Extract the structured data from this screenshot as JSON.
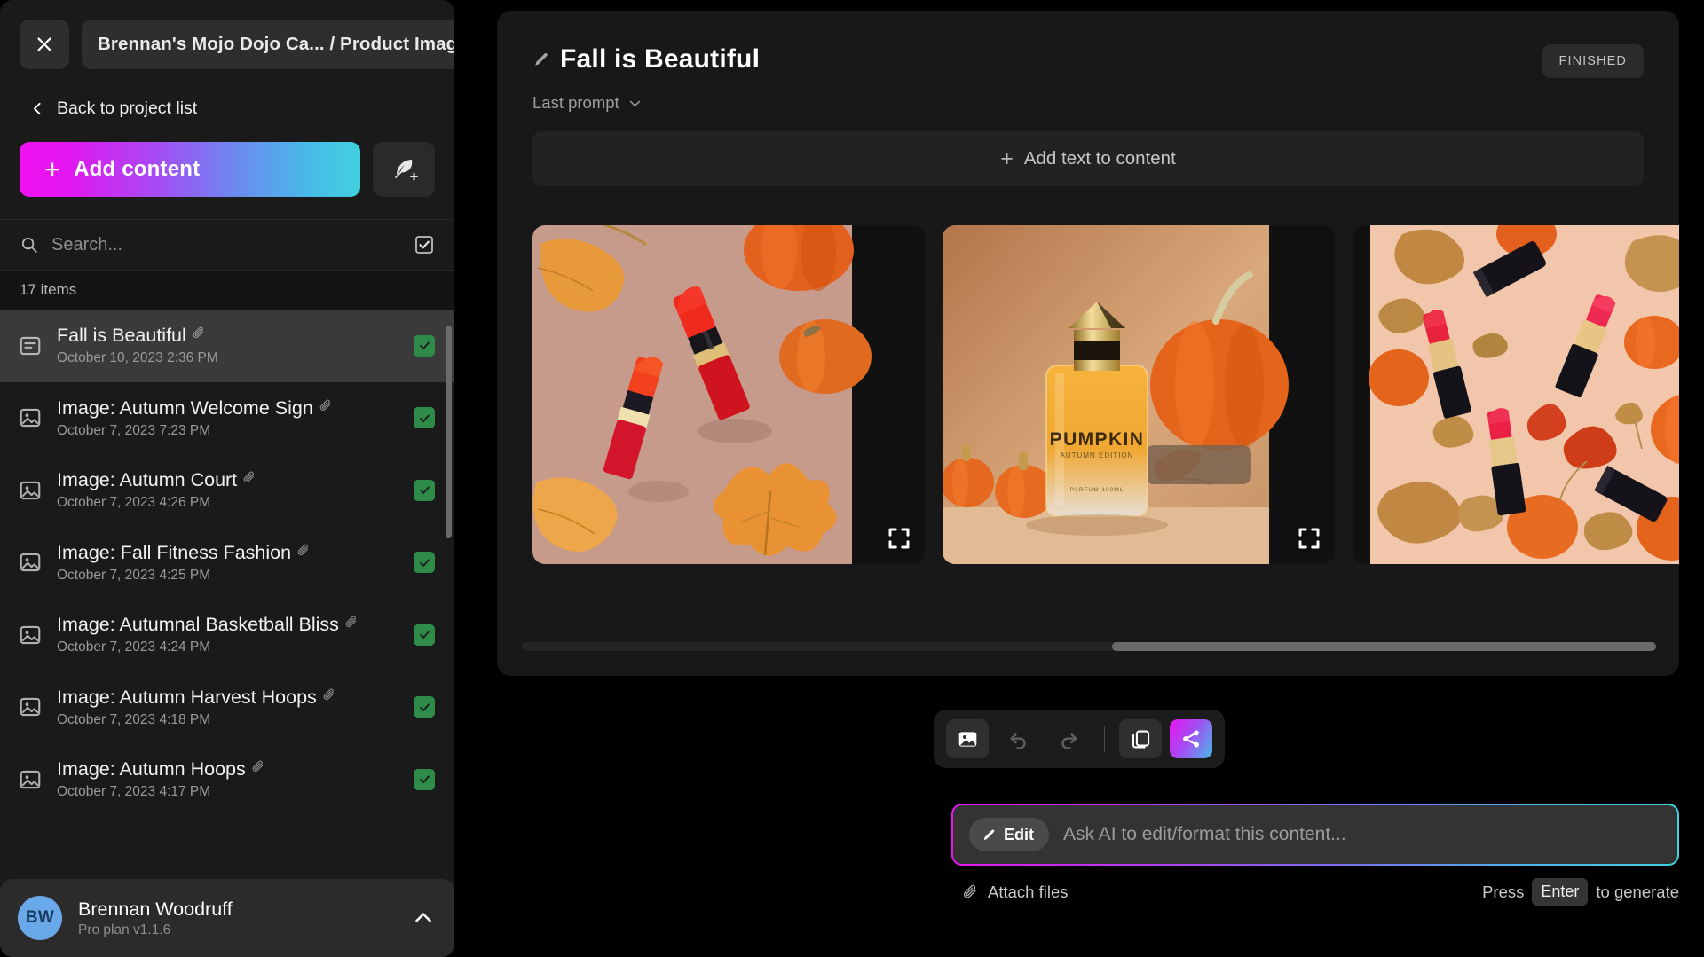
{
  "sidebar": {
    "close_icon": "close-icon",
    "project_selector": {
      "label": "Brennan's Mojo Dojo Ca... / Product Imagery",
      "chevron": "chevron-down-icon"
    },
    "back_link": "Back to project list",
    "add_content_button": "Add content",
    "add_content_plus": "+",
    "quill_button_icon": "feather-plus-icon",
    "search": {
      "placeholder": "Search...",
      "value": "",
      "select_all_icon": "checkbox-checked-icon"
    },
    "items_count": "17 items",
    "items": [
      {
        "icon": "document-icon",
        "title": "Fall is Beautiful",
        "date": "October 10, 2023 2:36 PM",
        "attached": true,
        "checked": true,
        "active": true
      },
      {
        "icon": "image-icon",
        "title": "Image: Autumn Welcome Sign",
        "date": "October 7, 2023 7:23 PM",
        "attached": true,
        "checked": true,
        "active": false
      },
      {
        "icon": "image-icon",
        "title": "Image: Autumn Court",
        "date": "October 7, 2023 4:26 PM",
        "attached": true,
        "checked": true,
        "active": false
      },
      {
        "icon": "image-icon",
        "title": "Image: Fall Fitness Fashion",
        "date": "October 7, 2023 4:25 PM",
        "attached": true,
        "checked": true,
        "active": false
      },
      {
        "icon": "image-icon",
        "title": "Image: Autumnal Basketball Bliss",
        "date": "October 7, 2023 4:24 PM",
        "attached": true,
        "checked": true,
        "active": false
      },
      {
        "icon": "image-icon",
        "title": "Image: Autumn Harvest Hoops",
        "date": "October 7, 2023 4:18 PM",
        "attached": true,
        "checked": true,
        "active": false
      },
      {
        "icon": "image-icon",
        "title": "Image: Autumn Hoops",
        "date": "October 7, 2023 4:17 PM",
        "attached": true,
        "checked": true,
        "active": false
      }
    ],
    "profile": {
      "initials": "BW",
      "name": "Brennan Woodruff",
      "plan": "Pro plan v1.1.6",
      "chevron": "chevron-up-icon"
    }
  },
  "main": {
    "title": "Fall is Beautiful",
    "title_icon": "pencil-icon",
    "status_badge": "FINISHED",
    "last_prompt": "Last prompt",
    "add_text_button": "Add text to content",
    "add_text_plus": "+",
    "gallery": [
      {
        "alt": "Two red lipsticks with gold bands among maple leaves and pumpkins",
        "expand_icon": "expand-icon"
      },
      {
        "alt": "PUMPKIN perfume bottle with pumpkins and autumn leaves",
        "expand_icon": "expand-icon",
        "label": "PUMPKIN"
      },
      {
        "alt": "Flat lay of black and gold lipsticks with leaves and pumpkins on peach background",
        "expand_icon": "expand-icon"
      }
    ],
    "toolbar": [
      {
        "name": "insert-image-button",
        "icon": "image-icon",
        "state": "active"
      },
      {
        "name": "undo-button",
        "icon": "undo-icon",
        "state": "disabled"
      },
      {
        "name": "redo-button",
        "icon": "redo-icon",
        "state": "disabled"
      },
      {
        "name": "divider",
        "icon": "divider",
        "state": "static"
      },
      {
        "name": "duplicate-button",
        "icon": "copy-icon",
        "state": "active"
      },
      {
        "name": "share-button",
        "icon": "share-icon",
        "state": "accent"
      }
    ],
    "prompt": {
      "mode_label": "Edit",
      "mode_icon": "pencil-icon",
      "placeholder": "Ask AI to edit/format this content...",
      "value": "",
      "attach_label": "Attach files",
      "attach_icon": "paperclip-icon",
      "hint_prefix": "Press",
      "hint_key": "Enter",
      "hint_suffix": "to generate"
    }
  },
  "colors": {
    "accent_pink": "#e915ef",
    "accent_cyan": "#3ed2e0",
    "check_green": "#2f8b49",
    "avatar_blue": "#6aa9e9",
    "sidebar_bg": "#1a1a1a",
    "card_bg": "#181818"
  }
}
